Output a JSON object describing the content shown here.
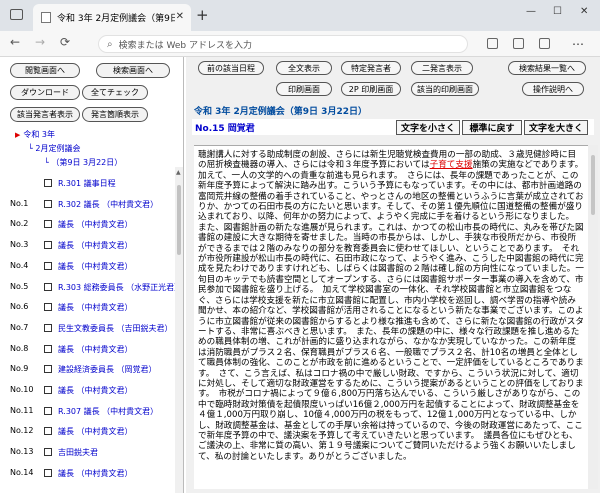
{
  "browser": {
    "tab_title": "令和 3年 2月定例議会（第9日 3月",
    "tab_close": "✕",
    "new_tab": "+",
    "address_placeholder": "検索または Web アドレスを入力",
    "back": "←",
    "forward": "→",
    "refresh": "⟳",
    "home": "⌂",
    "more": "…",
    "minimize": "—",
    "maximize": "☐",
    "close": "✕"
  },
  "left": {
    "buttons": {
      "reading": "閲覧画面へ",
      "search": "検索画面へ",
      "download": "ダウンロード",
      "check_all": "全てチェック",
      "speaker_list": "該当発言者表示",
      "speaker_index": "発言箇順表示"
    },
    "tree": {
      "year": "令和 3年",
      "session": "2月定例議会",
      "day": "（第9日 3月22日）"
    },
    "items": [
      {
        "num": "",
        "text": "R.301 議事日程"
      },
      {
        "num": "No.1",
        "text": "R.302 議長 （中村貴文君）"
      },
      {
        "num": "No.2",
        "text": "議長 （中村貴文君）"
      },
      {
        "num": "No.3",
        "text": "議長 （中村貴文君）"
      },
      {
        "num": "No.4",
        "text": "議長 （中村貴文君）"
      },
      {
        "num": "No.5",
        "text": "R.303 総務委員長 （水野正光君）"
      },
      {
        "num": "No.6",
        "text": "議長 （中村貴文君）"
      },
      {
        "num": "No.7",
        "text": "民生文教委員長 （吉田鋭夫君）"
      },
      {
        "num": "No.8",
        "text": "議長 （中村貴文君）"
      },
      {
        "num": "No.9",
        "text": "建設経済委員長 （岡覚君）"
      },
      {
        "num": "No.10",
        "text": "議長 （中村貴文君）"
      },
      {
        "num": "No.11",
        "text": "R.307 議長 （中村貴文君）"
      },
      {
        "num": "No.12",
        "text": "議長 （中村貴文君）"
      },
      {
        "num": "No.13",
        "text": "吉田鋭夫君"
      },
      {
        "num": "No.14",
        "text": "議長 （中村貴文君）"
      }
    ]
  },
  "right": {
    "buttons": {
      "prev_doc": "前の該当日程",
      "full_text": "全文表示",
      "specific_speaker": "特定発言者",
      "two_screen": "二発言表示",
      "result_list": "検索結果一覧へ",
      "print_screen": "印刷画面",
      "print_2p": "2P 印刷画面",
      "print_doc": "該当的印刷画面",
      "operation": "操作説明へ"
    },
    "meeting_title": "令和 3年 2月定例議会（第9日 3月22日）",
    "speaker": "No.15 岡覚君",
    "font_buttons": {
      "small": "文字を小さく",
      "normal": "標準に戻す",
      "large": "文字を大きく"
    },
    "text_before": "聴謝講人に対する助成制度の創設、さらには新生児聴覚検査費用の一部の助成、３歳児健診時に目の屈折検査機器の導入、さらには令和３年度予算においては",
    "text_highlight": "子育て支援",
    "text_after": "施策の実施などであります。加えて、一人の文学的への貴重な前進も見られます。　さらには、長年の課題であったことが、この新年度予算によって解決に踏み出す。こういう予算にもなっています。その中には、都市計画道路の富岡荒井線の整備の着手されていること、やっとさんの地区の整備というふうに言葉が成立されておりか、かつての石田市長の方にたいと思います。そして、その第１優先順位に国道整備の整備が盛り込まれており、以降、何年かの努力によって、ようやく完成に手を着けるという形になりました。　また、図書館計画の新たな進展が見られます。これは、かつての松山市長の時代に、丸みを帯びた図書館の建設に大きな期待を寄せました。当時の市長からは、しかし、手狭な市役所だから、市役所ができるまでは２階のみなりの部分を教育委員会に使わせてほしい、ということであります。　それが市役所建設が松山市長の時代に、石田市政になって、ようやく進み、こうした中図書館の時代に完成を見たわけでありますけれども、しばらくは図書館の２階は確し館の方向性になっていました。一句目のキッテでも読書空間としてオープンする、さらには図書館サポーター事業の導入を含めて、市民参加で図書館を盛り上げる。　加えて学校図書室の一体化、それ学校図書館と市立図書館をつなぐ、さらには学校支援を新たに市立図書館に配置し、市内小学校を巡回し、調べ学習の指導や読み聞かせ、本の紹介など、学校図書館が活用されることになるという新たな事業でございます。このように市立図書館が従来の図書館からするとより様な推進も含めて、さらに新たな図書館の行政がスタートする、非常に喜ぶべきと思います。　また、長年の課題の中に、様々な行政課題を推し進めるための職員体制の増、これが計画的に盛り込まれながら、なかなか実現していなかった。この新年度は消防職員がプラス２名、保育職員がプラス６名、一般職でプラス２名、計10名の増員と全体として職員体制の強化、このことが市政を前に進めるということで、一定評価をしているところであります。　さて、こう言えば、私はコロナ禍の中で厳しい財政、ですから、こういう状況に対して、適切に対処し、そして適切な財政運営をするために、こういう提案があるということの評価をしております。　市税がコロナ禍によって９億６,800万円落ち込んでいる、こういう厳しさがありながら、この中で臨時財政対策債を起債限度いっぱい16億２,000万円を起債することによって、財政調整基金を４億１,000万円取り崩し、10億４,000万円の税をもって、12億１,000万円となっている中、しかし、財政調整基金は、基金としての手厚い余裕は持っているので、今後の財政運営にあたって、ここで新年度予算の中で、議決案を予算して考えていきたいと思っています。　議員各位にもぜひとも、ご議決の上、非常に質の高い、第１９号議案についてご賛同いただけるよう強くお願いいたしまして、私の討論といたします。ありがとうございました。"
  }
}
